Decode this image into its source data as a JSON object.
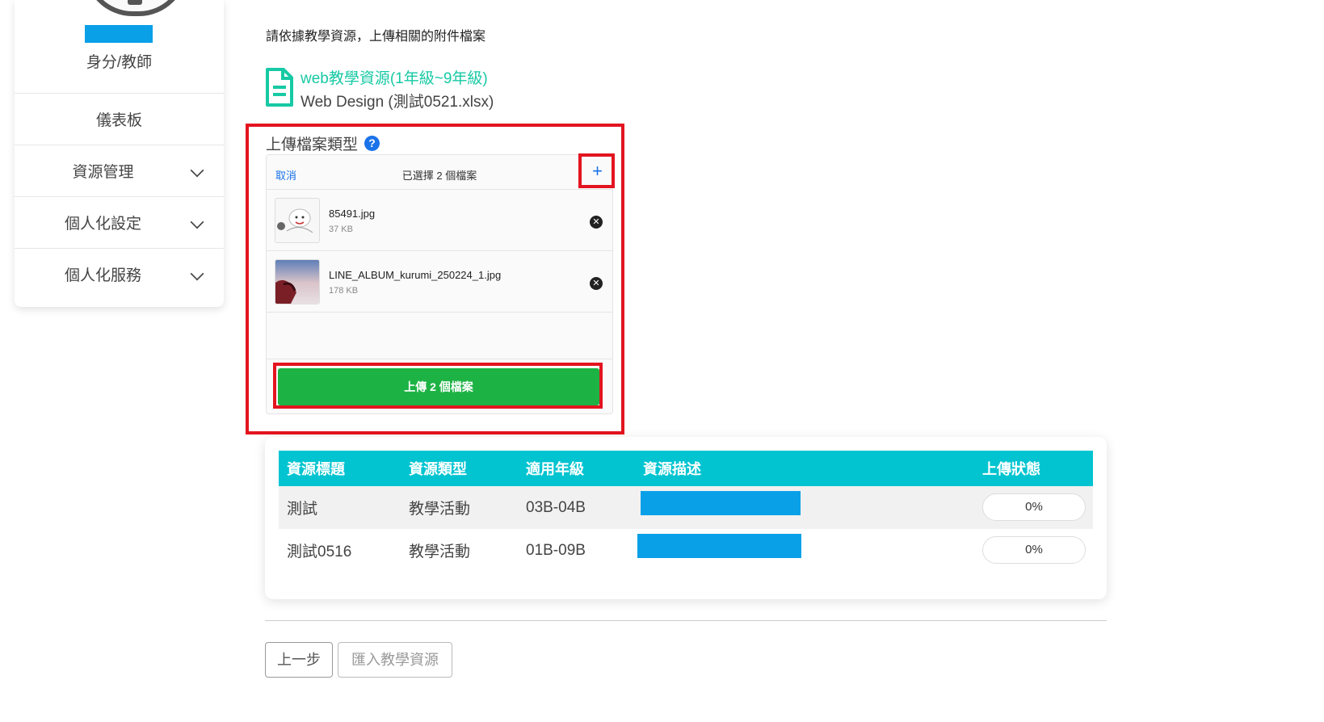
{
  "sidebar": {
    "role": "身分/教師",
    "menu": [
      {
        "label": "儀表板",
        "has_sub": false
      },
      {
        "label": "資源管理",
        "has_sub": true
      },
      {
        "label": "個人化設定",
        "has_sub": true
      },
      {
        "label": "個人化服務",
        "has_sub": true
      }
    ]
  },
  "main": {
    "instruction": "請依據教學資源，上傳相關的附件檔案",
    "resource": {
      "title": "web教學資源(1年級~9年級)",
      "file": "Web Design (測試0521.xlsx)"
    },
    "upload_label": "上傳檔案類型",
    "uploader": {
      "cancel": "取消",
      "selected": "已選擇 2 個檔案",
      "add_icon": "plus-icon",
      "files": [
        {
          "name": "85491.jpg",
          "size": "37 KB"
        },
        {
          "name": "LINE_ALBUM_kurumi_250224_1.jpg",
          "size": "178 KB"
        }
      ],
      "upload_button": "上傳 2 個檔案"
    },
    "table": {
      "headers": [
        "資源標題",
        "資源類型",
        "適用年級",
        "資源描述",
        "上傳狀態"
      ],
      "rows": [
        {
          "title": "測試",
          "type": "教學活動",
          "grade": "03B-04B",
          "status": "0%"
        },
        {
          "title": "測試0516",
          "type": "教學活動",
          "grade": "01B-09B",
          "status": "0%"
        }
      ]
    },
    "buttons": {
      "prev": "上一步",
      "import": "匯入教學資源"
    }
  },
  "colors": {
    "accent_teal": "#02c4d1",
    "resource_title": "#17c9a4",
    "upload_green": "#1db344",
    "highlight_red": "#e3141f",
    "link_blue": "#1a73e8"
  }
}
